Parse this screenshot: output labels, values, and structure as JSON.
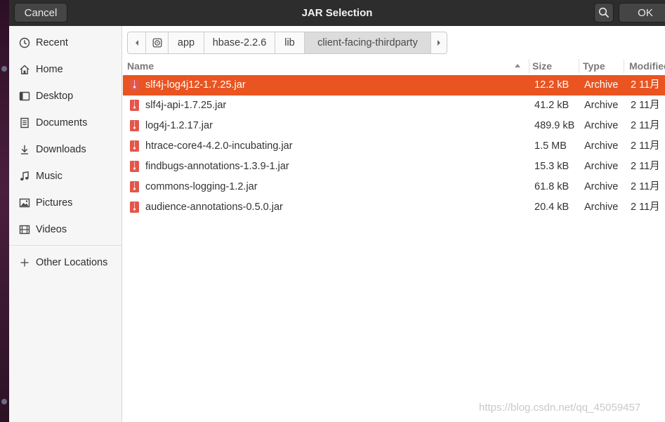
{
  "dialog": {
    "title": "JAR Selection",
    "cancel_label": "Cancel",
    "ok_label": "OK",
    "search_icon": "search-icon"
  },
  "sidebar": {
    "items": [
      {
        "label": "Recent",
        "icon": "clock-icon"
      },
      {
        "label": "Home",
        "icon": "home-icon"
      },
      {
        "label": "Desktop",
        "icon": "desktop-icon"
      },
      {
        "label": "Documents",
        "icon": "document-icon"
      },
      {
        "label": "Downloads",
        "icon": "download-icon"
      },
      {
        "label": "Music",
        "icon": "music-icon"
      },
      {
        "label": "Pictures",
        "icon": "picture-icon"
      },
      {
        "label": "Videos",
        "icon": "video-icon"
      }
    ],
    "other_locations": {
      "label": "Other Locations",
      "icon": "plus-icon"
    }
  },
  "pathbar": {
    "segments": [
      "app",
      "hbase-2.2.6",
      "lib",
      "client-facing-thirdparty"
    ],
    "active": "client-facing-thirdparty"
  },
  "file_list": {
    "columns": [
      "Name",
      "Size",
      "Type",
      "Modified"
    ],
    "sort_column": "Name",
    "sort_direction": "ascending",
    "rows": [
      {
        "name": "slf4j-log4j12-1.7.25.jar",
        "size": "12.2 kB",
        "type": "Archive",
        "modified": "2 11月",
        "selected": true
      },
      {
        "name": "slf4j-api-1.7.25.jar",
        "size": "41.2 kB",
        "type": "Archive",
        "modified": "2 11月",
        "selected": false
      },
      {
        "name": "log4j-1.2.17.jar",
        "size": "489.9 kB",
        "type": "Archive",
        "modified": "2 11月",
        "selected": false
      },
      {
        "name": "htrace-core4-4.2.0-incubating.jar",
        "size": "1.5 MB",
        "type": "Archive",
        "modified": "2 11月",
        "selected": false
      },
      {
        "name": "findbugs-annotations-1.3.9-1.jar",
        "size": "15.3 kB",
        "type": "Archive",
        "modified": "2 11月",
        "selected": false
      },
      {
        "name": "commons-logging-1.2.jar",
        "size": "61.8 kB",
        "type": "Archive",
        "modified": "2 11月",
        "selected": false
      },
      {
        "name": "audience-annotations-0.5.0.jar",
        "size": "20.4 kB",
        "type": "Archive",
        "modified": "2 11月",
        "selected": false
      }
    ]
  },
  "colors": {
    "selection": "#e95420",
    "headerbar": "#2d2d2d"
  },
  "watermark": "https://blog.csdn.net/qq_45059457"
}
